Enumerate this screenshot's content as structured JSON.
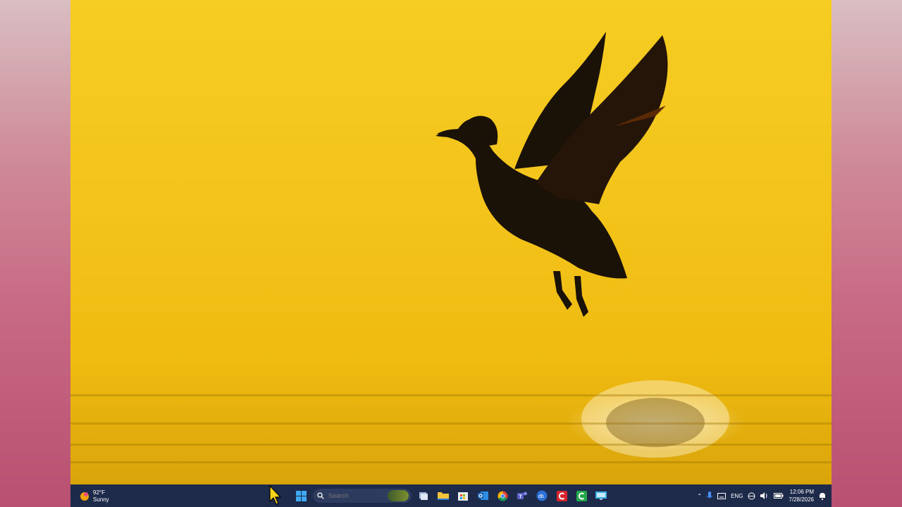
{
  "weather": {
    "temp": "92°F",
    "condition": "Sunny",
    "icon": "sun-cloud-icon"
  },
  "search": {
    "placeholder": "Search"
  },
  "taskbar_apps": [
    {
      "name": "start-button",
      "icon": "windows-logo-icon"
    },
    {
      "name": "task-view",
      "icon": "task-view-icon"
    },
    {
      "name": "file-explorer",
      "icon": "folder-icon"
    },
    {
      "name": "microsoft-store",
      "icon": "store-icon"
    },
    {
      "name": "outlook",
      "icon": "outlook-icon"
    },
    {
      "name": "chrome",
      "icon": "chrome-icon"
    },
    {
      "name": "teams",
      "icon": "teams-icon"
    },
    {
      "name": "database-app",
      "icon": "db-icon"
    },
    {
      "name": "red-app",
      "icon": "red-app-icon"
    },
    {
      "name": "green-app",
      "icon": "green-app-icon"
    },
    {
      "name": "remote-desktop",
      "icon": "remote-desktop-icon"
    }
  ],
  "tray": {
    "language": "ENG"
  },
  "clock": {
    "time": "12:06 PM",
    "date": "7/28/2026"
  },
  "colors": {
    "taskbar": "#1d2a4a",
    "wallpaper": "#f3c31a"
  }
}
